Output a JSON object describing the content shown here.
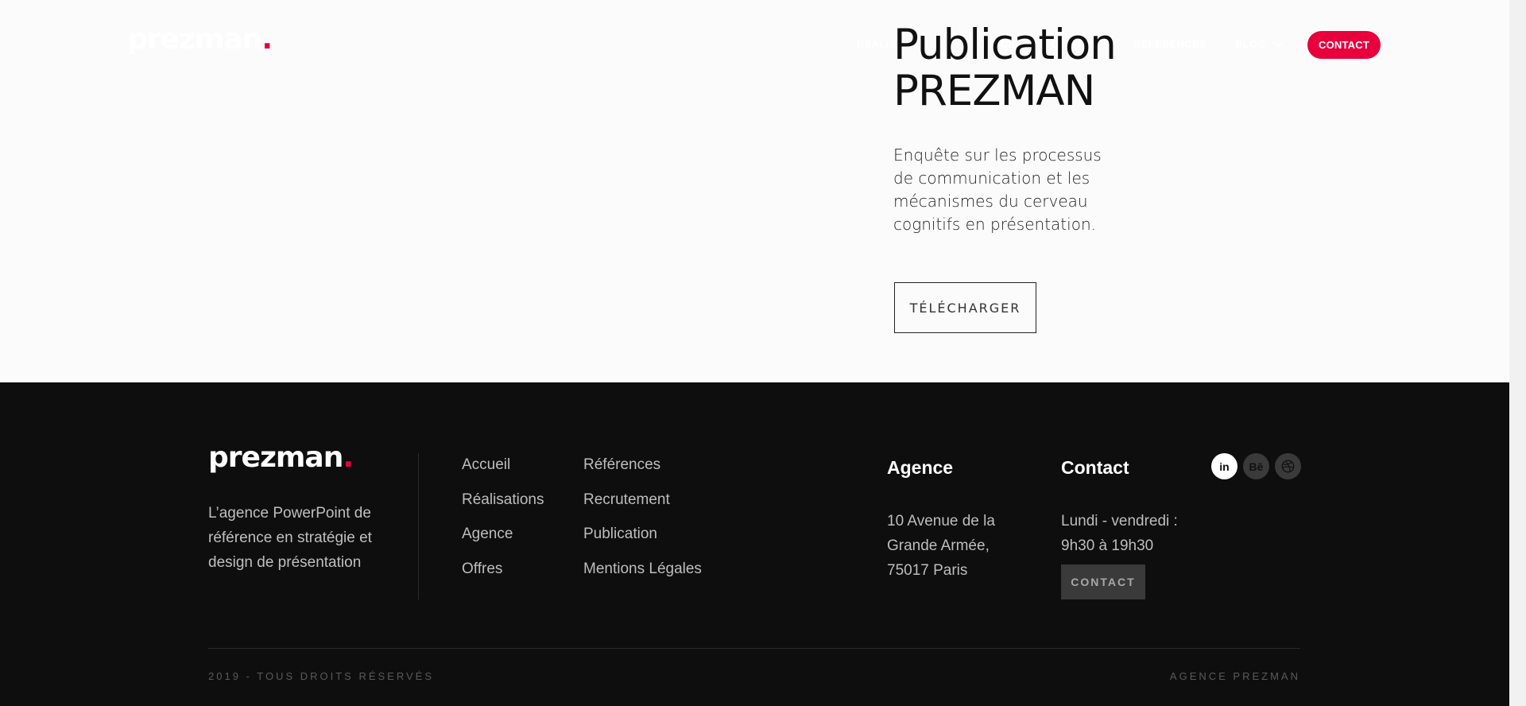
{
  "header": {
    "logo": "prezman",
    "logo_dot": ".",
    "nav": [
      "Réalisations",
      "Agence",
      "Offres",
      "Références",
      "Blog"
    ],
    "contact_button": "CONTACT"
  },
  "publication": {
    "title_line1": "Publication",
    "title_line2": "PREZMAN",
    "description": "Enquête sur les processus de communication et les mécanismes du cerveau cognitifs en présentation.",
    "download_button": "TÉLÉCHARGER"
  },
  "footer": {
    "logo": "prezman",
    "logo_dot": ".",
    "tagline": "L’agence PowerPoint de référence en stratégie et design de présentation",
    "links_col1": [
      "Accueil",
      "Réalisations",
      "Agence",
      "Offres"
    ],
    "links_col2": [
      "Références",
      "Recrutement",
      "Publication",
      "Mentions Légales"
    ],
    "agence": {
      "heading": "Agence",
      "address_line1": "10 Avenue de la",
      "address_line2": "Grande Armée,",
      "address_line3": "75017 Paris"
    },
    "contact": {
      "heading": "Contact",
      "hours_line1": "Lundi - vendredi :",
      "hours_line2": "9h30 à 19h30",
      "button": "CONTACT"
    },
    "social": {
      "linkedin": "in",
      "behance": "Bē",
      "dribbble": "dribbble-icon"
    },
    "copyright": "2019 - TOUS DROITS RÉSERVÉS",
    "brand": "AGENCE PREZMAN"
  },
  "colors": {
    "accent": "#e8003d",
    "footer_bg": "#0e0e0f",
    "hero_bg": "#fbfbfb"
  }
}
